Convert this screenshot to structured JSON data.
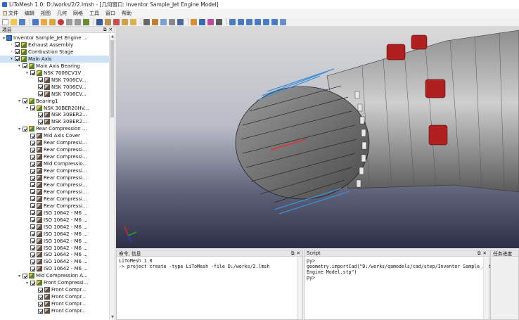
{
  "window": {
    "title": "LiToMesh 1.0: D:/works/2/2.lmsh - [几何窗口: Inventor Sample_Jet Engine Model]"
  },
  "menu": [
    {
      "label": "文件"
    },
    {
      "label": "编辑"
    },
    {
      "label": "视图"
    },
    {
      "label": "几何"
    },
    {
      "label": "网格"
    },
    {
      "label": "工具"
    },
    {
      "label": "窗口"
    },
    {
      "label": "帮助"
    }
  ],
  "tree_panel": {
    "title": "项目",
    "float": "⧉",
    "close": "✕"
  },
  "tree": [
    {
      "label": "Inventor Sample_Jet Engine ...",
      "depth": 0,
      "arrow": "v",
      "icon": "root"
    },
    {
      "label": "Exhaust Assembly",
      "depth": 1,
      "arrow": ">",
      "icon": "asm"
    },
    {
      "label": "Combustion Stage",
      "depth": 1,
      "arrow": ">",
      "icon": "asm"
    },
    {
      "label": "Main Axis",
      "depth": 1,
      "arrow": "v",
      "icon": "asm",
      "selected": true
    },
    {
      "label": "Main Axis Bearing",
      "depth": 2,
      "arrow": "v",
      "icon": "asm"
    },
    {
      "label": "NSK 7006CV1V",
      "depth": 3,
      "arrow": "v",
      "icon": "asm"
    },
    {
      "label": "NSK 7006CV...",
      "depth": 4,
      "arrow": "",
      "icon": "part"
    },
    {
      "label": "NSK 7006CV...",
      "depth": 4,
      "arrow": "",
      "icon": "part"
    },
    {
      "label": "NSK 7006CV...",
      "depth": 4,
      "arrow": "",
      "icon": "part"
    },
    {
      "label": "Bearing1",
      "depth": 2,
      "arrow": "v",
      "icon": "asm"
    },
    {
      "label": "NSK 30BER20HV...",
      "depth": 3,
      "arrow": "v",
      "icon": "asm"
    },
    {
      "label": "NSK 30BER2...",
      "depth": 4,
      "arrow": "",
      "icon": "part"
    },
    {
      "label": "NSK 30BER2...",
      "depth": 4,
      "arrow": "",
      "icon": "part"
    },
    {
      "label": "Rear Compression ...",
      "depth": 2,
      "arrow": "v",
      "icon": "asm"
    },
    {
      "label": "Mid Axis Cover",
      "depth": 3,
      "arrow": "",
      "icon": "part"
    },
    {
      "label": "Rear Compressi...",
      "depth": 3,
      "arrow": "",
      "icon": "part"
    },
    {
      "label": "Rear Compressi...",
      "depth": 3,
      "arrow": "",
      "icon": "part"
    },
    {
      "label": "Rear Compressi...",
      "depth": 3,
      "arrow": "",
      "icon": "part"
    },
    {
      "label": "Mid Compressio...",
      "depth": 3,
      "arrow": "",
      "icon": "part"
    },
    {
      "label": "Rear Compressi...",
      "depth": 3,
      "arrow": "",
      "icon": "part"
    },
    {
      "label": "Rear Compressi...",
      "depth": 3,
      "arrow": "",
      "icon": "part"
    },
    {
      "label": "Rear Compressi...",
      "depth": 3,
      "arrow": "",
      "icon": "part"
    },
    {
      "label": "Rear Compressi...",
      "depth": 3,
      "arrow": "",
      "icon": "part"
    },
    {
      "label": "Rear Compressi...",
      "depth": 3,
      "arrow": "",
      "icon": "part"
    },
    {
      "label": "Rear Compressi...",
      "depth": 3,
      "arrow": "",
      "icon": "part"
    },
    {
      "label": "ISO 10642 - M6 ...",
      "depth": 3,
      "arrow": "",
      "icon": "part"
    },
    {
      "label": "ISO 10642 - M6 ...",
      "depth": 3,
      "arrow": "",
      "icon": "part"
    },
    {
      "label": "ISO 10642 - M6 ...",
      "depth": 3,
      "arrow": "",
      "icon": "part"
    },
    {
      "label": "ISO 10642 - M6 ...",
      "depth": 3,
      "arrow": "",
      "icon": "part"
    },
    {
      "label": "ISO 10642 - M6 ...",
      "depth": 3,
      "arrow": "",
      "icon": "part"
    },
    {
      "label": "ISO 10642 - M6 ...",
      "depth": 3,
      "arrow": "",
      "icon": "part"
    },
    {
      "label": "ISO 10642 - M6 ...",
      "depth": 3,
      "arrow": "",
      "icon": "part"
    },
    {
      "label": "ISO 10642 - M6 ...",
      "depth": 3,
      "arrow": "",
      "icon": "part"
    },
    {
      "label": "ISO 10642 - M6 ...",
      "depth": 3,
      "arrow": "",
      "icon": "part"
    },
    {
      "label": "Mid Compression A...",
      "depth": 2,
      "arrow": "v",
      "icon": "asm"
    },
    {
      "label": "Front Compressi...",
      "depth": 3,
      "arrow": "v",
      "icon": "asm"
    },
    {
      "label": "Front Compr...",
      "depth": 4,
      "arrow": "",
      "icon": "part"
    },
    {
      "label": "Front Compr...",
      "depth": 4,
      "arrow": "",
      "icon": "part"
    },
    {
      "label": "Front Compr...",
      "depth": 4,
      "arrow": "",
      "icon": "part"
    },
    {
      "label": "Front Compr...",
      "depth": 4,
      "arrow": "",
      "icon": "part"
    }
  ],
  "command_panel": {
    "title": "命令, 信息",
    "lines": "LiToMesh 1.0\n-> project create -type LiToMesh -file D:/works/2.lmsh"
  },
  "script_panel": {
    "title": "Script",
    "lines": "py>\ngeometry.importCad(\"D:/works/qamodels/cad/step/Inventor Sample_Jet\nEngine Model.stp\")\npy>"
  },
  "task_panel": {
    "title": "任务进度"
  },
  "colors": {
    "selection": "#cde2f7",
    "viewport_top": "#d9d9d9",
    "viewport_bottom": "#2c2f45"
  }
}
